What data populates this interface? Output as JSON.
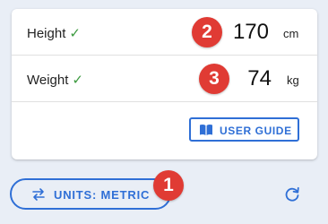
{
  "measurements": {
    "height": {
      "label": "Height",
      "status": "✓",
      "value": "170",
      "unit": "cm",
      "marker": "2"
    },
    "weight": {
      "label": "Weight",
      "status": "✓",
      "value": "74",
      "unit": "kg",
      "marker": "3"
    }
  },
  "guide": {
    "label": "USER GUIDE",
    "icon": "book-open-icon"
  },
  "units": {
    "label": "UNITS: METRIC",
    "icon": "swap-arrows-icon",
    "marker": "1"
  },
  "reset": {
    "icon": "refresh-icon"
  },
  "colors": {
    "accent": "#2f6fd6",
    "marker": "#e03b34",
    "check": "#3c9a3f",
    "background": "#e9eef6"
  }
}
